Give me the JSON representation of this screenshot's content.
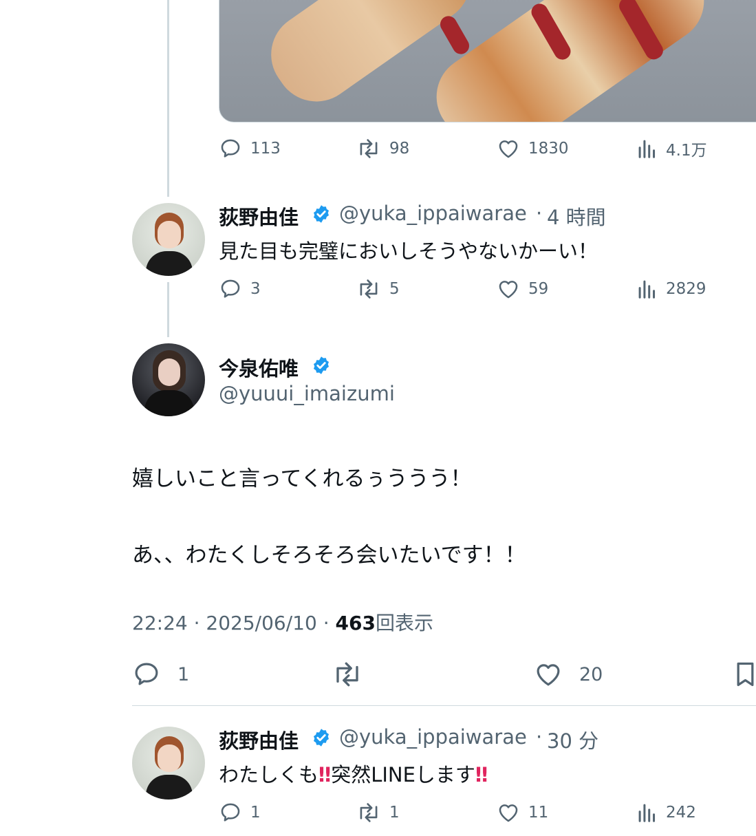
{
  "colors": {
    "text": "#0f1419",
    "secondary": "#536471",
    "verified": "#1d9bf0",
    "alert": "#e0245e",
    "border": "#cfd9de"
  },
  "top_tweet": {
    "actions": {
      "replies": "113",
      "retweets": "98",
      "likes": "1830",
      "views": "4.1万"
    }
  },
  "reply1": {
    "name": "荻野由佳",
    "handle": "@yuka_ippaiwarae",
    "dot": "·",
    "time": "4 時間",
    "text": "見た目も完璧においしそうやないかーい！",
    "actions": {
      "replies": "3",
      "retweets": "5",
      "likes": "59",
      "views": "2829"
    }
  },
  "main_tweet": {
    "name": "今泉佑唯",
    "handle": "@yuuui_imaizumi",
    "line1": "嬉しいこと言ってくれるぅううう！",
    "line2": "あ、、わたくしそろそろ会いたいです！！",
    "time": "22:24",
    "dot": "·",
    "date": "2025/06/10",
    "dot2": "·",
    "views": "463",
    "views_label": "回表示",
    "actions": {
      "replies": "1",
      "likes": "20"
    }
  },
  "reply2": {
    "name": "荻野由佳",
    "handle": "@yuka_ippaiwarae",
    "dot": "·",
    "time": "30 分",
    "text_a": "わたしくも",
    "emoji1": "‼",
    "text_b": "突然LINEします",
    "emoji2": "‼",
    "actions": {
      "replies": "1",
      "retweets": "1",
      "likes": "11",
      "views": "242"
    }
  },
  "icons": [
    "reply-icon",
    "retweet-icon",
    "like-icon",
    "views-icon",
    "verified-icon",
    "bookmark-icon"
  ]
}
